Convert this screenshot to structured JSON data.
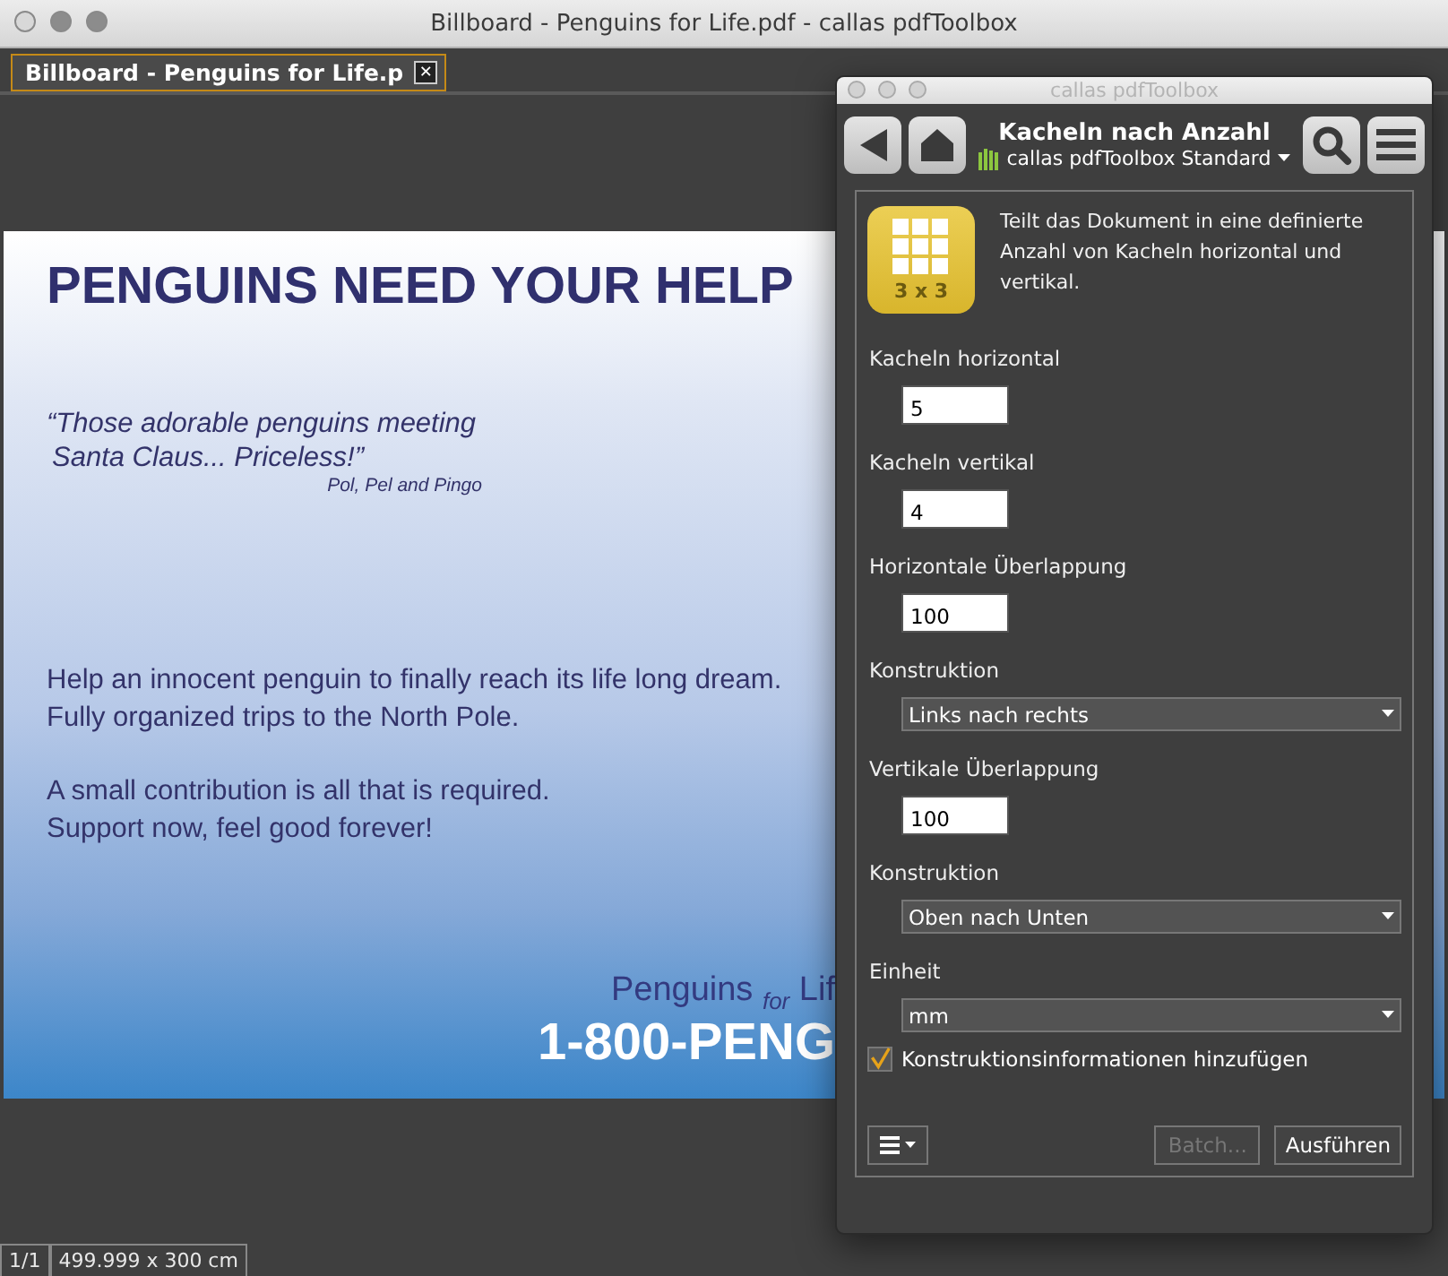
{
  "window": {
    "title": "Billboard - Penguins for Life.pdf - callas pdfToolbox"
  },
  "tabs": [
    {
      "label": "Billboard - Penguins for Life.p",
      "selected": true,
      "close": "✕"
    }
  ],
  "document": {
    "headline": "PENGUINS NEED YOUR HELP",
    "quote": [
      "“Those adorable penguins meeting",
      "Santa Claus... Priceless!”"
    ],
    "quote_author": "Pol, Pel and Pingo",
    "body": [
      [
        "Help an innocent penguin to finally reach its life long dream.",
        "Fully organized trips to the North Pole."
      ],
      [
        "A small contribution is all that is required.",
        "Support now, feel good forever!"
      ]
    ],
    "brand": "Penguins $_{for}$ Lif",
    "phone": "1-800-PENG"
  },
  "status_bar": [
    "1/1",
    "499.999 x 300 cm"
  ],
  "panel": {
    "title": "callas pdfToolbox",
    "heading": "Kacheln nach Anzahl",
    "profile": "callas pdfToolbox Standard",
    "icon_label": "3 x 3",
    "description": "Teilt das Dokument in eine definierte Anzahl von Kacheln horizontal und vertikal.",
    "fields": [
      {
        "kind": "input",
        "label": "Kacheln horizontal",
        "value": "5"
      },
      {
        "kind": "input",
        "label": "Kacheln vertikal",
        "value": "4"
      },
      {
        "kind": "input",
        "label": "Horizontale Überlappung",
        "value": "100"
      },
      {
        "kind": "select",
        "label": "Konstruktion",
        "value": "Links nach rechts"
      },
      {
        "kind": "input",
        "label": "Vertikale Überlappung",
        "value": "100"
      },
      {
        "kind": "select",
        "label": "Konstruktion",
        "value": "Oben nach Unten"
      },
      {
        "kind": "select",
        "label": "Einheit",
        "value": "mm"
      }
    ],
    "checkbox": {
      "label": "Konstruktionsinformationen hinzufügen",
      "checked": true
    },
    "buttons": [
      {
        "label": "Batch...",
        "disabled": true
      },
      {
        "label": "Ausführen",
        "disabled": false
      }
    ]
  }
}
